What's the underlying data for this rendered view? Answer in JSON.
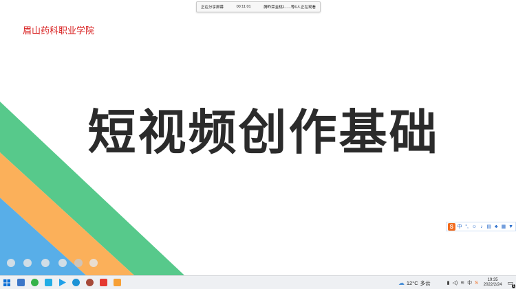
{
  "share_bar": {
    "status": "正在分享屏幕",
    "timer": "00:11:01",
    "viewers": "膊昨荣金桃1......等6人正在观看"
  },
  "slide": {
    "school_name": "眉山药科职业学院",
    "title": "短视频创作基础",
    "colors": {
      "green": "#57c98b",
      "orange": "#fbb05a",
      "blue": "#58aee8",
      "title": "#2b2b2b",
      "school": "#d81e1e"
    }
  },
  "ime_toolbar": {
    "logo": "S",
    "mode": "中",
    "items": [
      "punctuation-icon",
      "emoji-icon",
      "mic-icon",
      "keyboard-icon",
      "skin-icon",
      "toolbox-icon",
      "shirt-icon"
    ]
  },
  "taskbar": {
    "apps": [
      "windows-start-icon",
      "file-explorer-icon",
      "browser-green-icon",
      "bilibili-icon",
      "video-player-icon",
      "edge-icon",
      "game-icon",
      "wps-office-icon",
      "notes-icon"
    ],
    "weather": {
      "temp": "12°C",
      "condition": "多云"
    },
    "input_lang": "中",
    "time": "19:35",
    "date": "2022/2/24",
    "notification_count": "1"
  }
}
